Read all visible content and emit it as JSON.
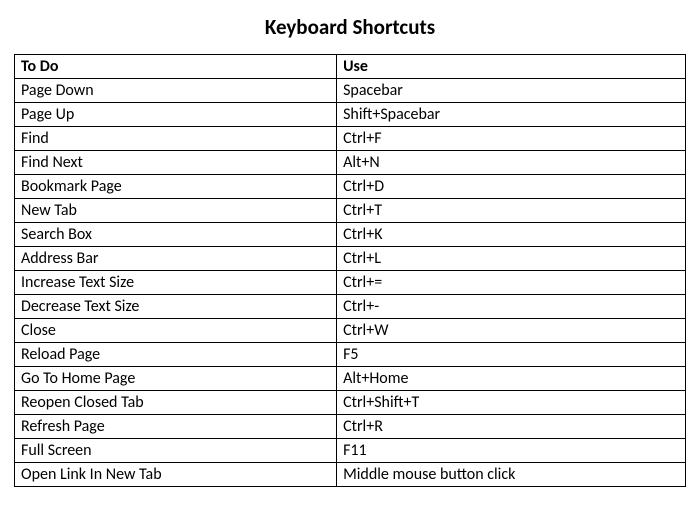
{
  "title": "Keyboard Shortcuts",
  "headers": {
    "action": "To Do",
    "key": "Use"
  },
  "rows": [
    {
      "action": "Page Down",
      "key": "Spacebar"
    },
    {
      "action": "Page Up",
      "key": "Shift+Spacebar"
    },
    {
      "action": "Find",
      "key": "Ctrl+F"
    },
    {
      "action": "Find Next",
      "key": "Alt+N"
    },
    {
      "action": "Bookmark Page",
      "key": "Ctrl+D"
    },
    {
      "action": "New Tab",
      "key": "Ctrl+T"
    },
    {
      "action": "Search Box",
      "key": "Ctrl+K"
    },
    {
      "action": "Address Bar",
      "key": "Ctrl+L"
    },
    {
      "action": "Increase Text Size",
      "key": "Ctrl+="
    },
    {
      "action": "Decrease Text Size",
      "key": "Ctrl+-"
    },
    {
      "action": "Close",
      "key": "Ctrl+W"
    },
    {
      "action": "Reload Page",
      "key": "F5"
    },
    {
      "action": "Go To Home Page",
      "key": "Alt+Home"
    },
    {
      "action": "Reopen Closed Tab",
      "key": "Ctrl+Shift+T"
    },
    {
      "action": "Refresh Page",
      "key": "Ctrl+R"
    },
    {
      "action": "Full Screen",
      "key": "F11"
    },
    {
      "action": "Open Link In New Tab",
      "key": "Middle mouse button click"
    }
  ]
}
